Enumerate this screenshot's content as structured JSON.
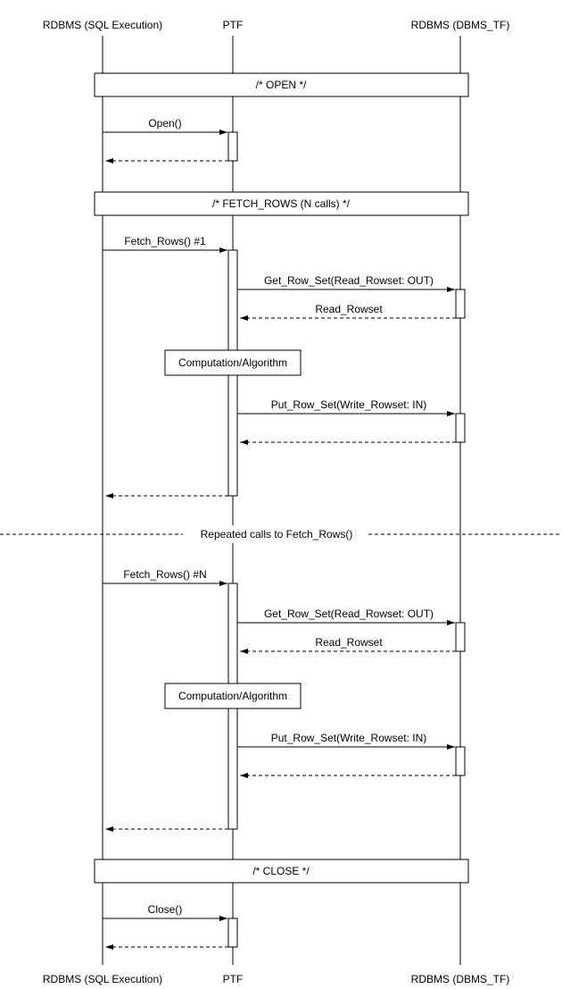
{
  "participants": {
    "left": "RDBMS (SQL Execution)",
    "mid": "PTF",
    "right": "RDBMS (DBMS_TF)"
  },
  "sections": {
    "open": "/* OPEN */",
    "fetch": "/* FETCH_ROWS (N calls) */",
    "close": "/* CLOSE */"
  },
  "messages": {
    "open": "Open()",
    "fetch1": "Fetch_Rows() #1",
    "fetchN": "Fetch_Rows() #N",
    "getrow": "Get_Row_Set(Read_Rowset: OUT)",
    "readrow": "Read_Rowset",
    "comp": "Computation/Algorithm",
    "putrow": "Put_Row_Set(Write_Rowset: IN)",
    "close": "Close()"
  },
  "divider": "Repeated calls to Fetch_Rows()"
}
